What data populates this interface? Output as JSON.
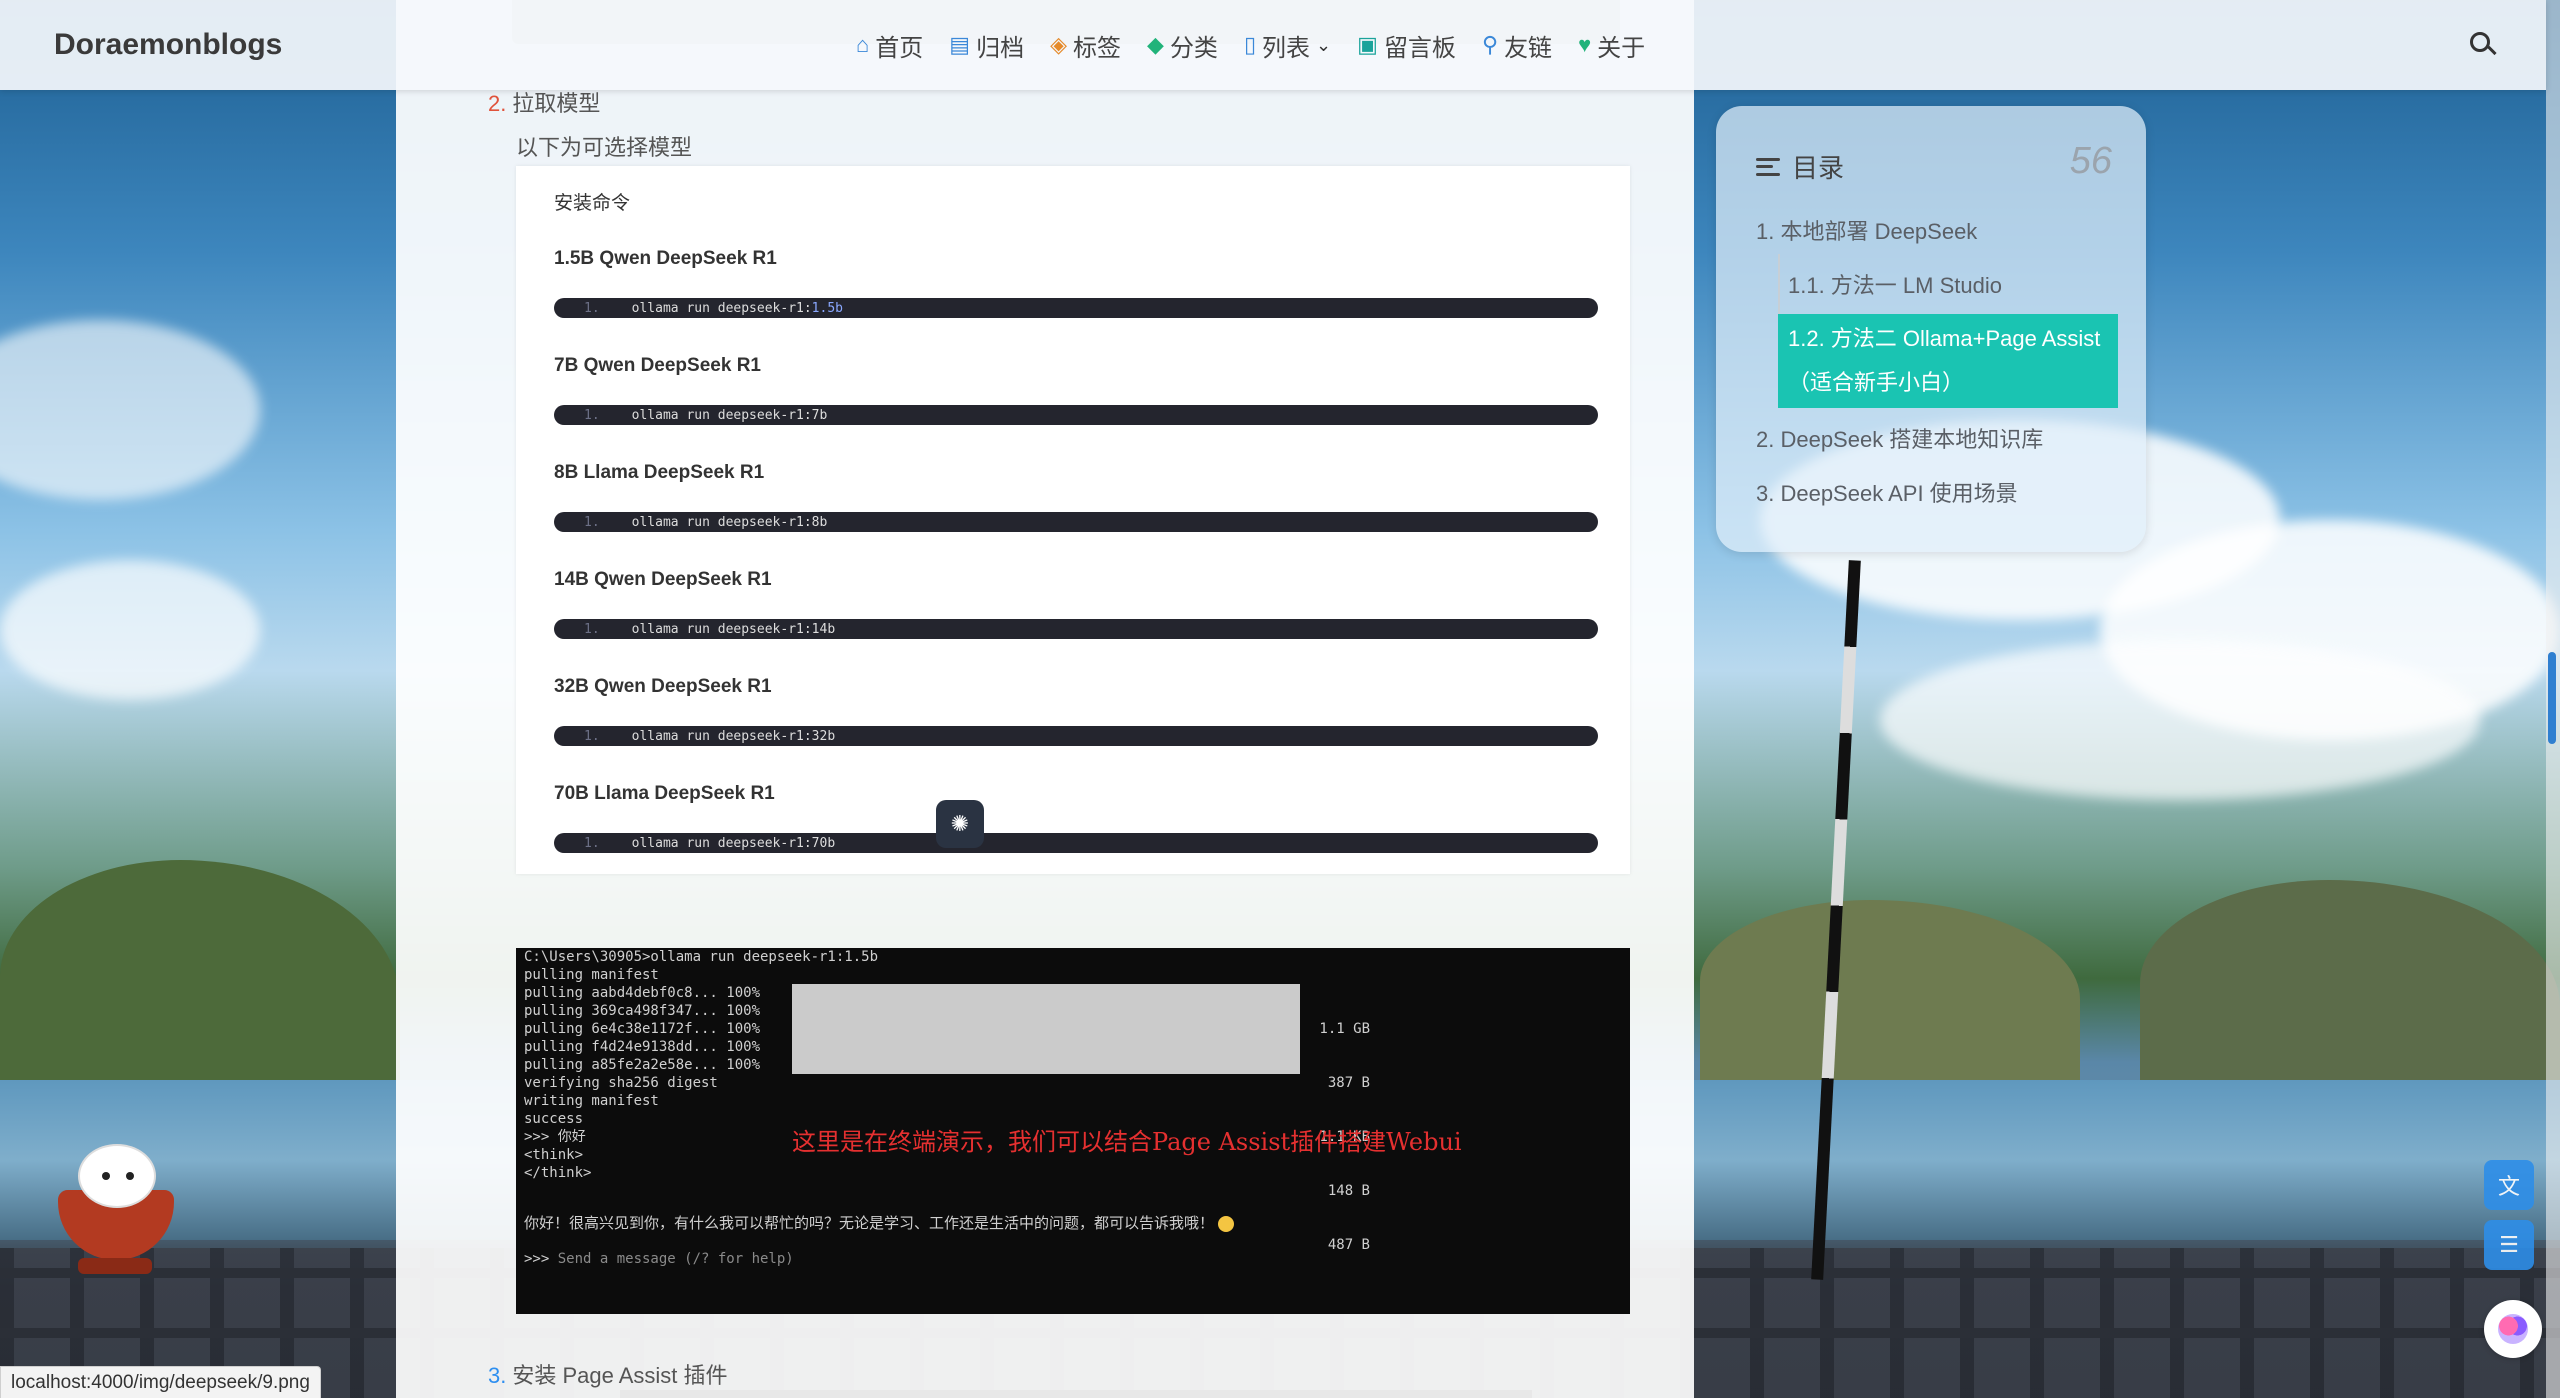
{
  "header": {
    "brand": "Doraemonblogs",
    "nav": [
      {
        "label": "首页",
        "icon": "home-icon"
      },
      {
        "label": "归档",
        "icon": "archive-icon"
      },
      {
        "label": "标签",
        "icon": "tag-icon"
      },
      {
        "label": "分类",
        "icon": "category-icon"
      },
      {
        "label": "列表",
        "icon": "list-icon"
      },
      {
        "label": "留言板",
        "icon": "message-board-icon"
      },
      {
        "label": "友链",
        "icon": "link-icon"
      },
      {
        "label": "关于",
        "icon": "heart-icon"
      }
    ],
    "search_icon": "search-icon"
  },
  "article": {
    "step2_num": "2.",
    "step2_label": "拉取模型",
    "step2_sub": "以下为可选择模型",
    "models_head": "安装命令",
    "models": [
      {
        "title": "1.5B Qwen DeepSeek R1",
        "line_no": "1.",
        "cmd_prefix": "ollama run deepseek-r1:",
        "cmd_tag": "1.5b"
      },
      {
        "title": "7B Qwen DeepSeek R1",
        "line_no": "1.",
        "cmd_prefix": "ollama run deepseek-r1:7b",
        "cmd_tag": ""
      },
      {
        "title": "8B Llama DeepSeek R1",
        "line_no": "1.",
        "cmd_prefix": "ollama run deepseek-r1:8b",
        "cmd_tag": ""
      },
      {
        "title": "14B Qwen DeepSeek R1",
        "line_no": "1.",
        "cmd_prefix": "ollama run deepseek-r1:14b",
        "cmd_tag": ""
      },
      {
        "title": "32B Qwen DeepSeek R1",
        "line_no": "1.",
        "cmd_prefix": "ollama run deepseek-r1:32b",
        "cmd_tag": ""
      },
      {
        "title": "70B Llama DeepSeek R1",
        "line_no": "1.",
        "cmd_prefix": "ollama run deepseek-r1:70b",
        "cmd_tag": ""
      }
    ],
    "terminal": {
      "lines": [
        "C:\\Users\\30905>ollama run deepseek-r1:1.5b",
        "pulling manifest",
        "pulling aabd4debf0c8... 100%",
        "pulling 369ca498f347... 100%",
        "pulling 6e4c38e1172f... 100%",
        "pulling f4d24e9138dd... 100%",
        "pulling a85fe2a2e58e... 100%",
        "verifying sha256 digest",
        "writing manifest",
        "success",
        ">>> 你好",
        "<think>",
        "",
        "</think>"
      ],
      "sizes": [
        "1.1 GB",
        "387 B",
        "1.1 KB",
        "148 B",
        "487 B"
      ],
      "note": "这里是在终端演示，我们可以结合Page Assist插件搭建Webui",
      "reply": "你好！很高兴见到你，有什么我可以帮忙的吗？无论是学习、工作还是生活中的问题，都可以告诉我哦！",
      "prompt": ">>> ",
      "prompt_placeholder": "Send a message (/? for help)"
    },
    "step3_num": "3.",
    "step3_label": "安装 Page Assist 插件"
  },
  "toc": {
    "title": "目录",
    "count": "56",
    "items": [
      "1. 本地部署 DeepSeek",
      "1.1. 方法一 LM Studio",
      "1.2. 方法二 Ollama+Page Assist（适合新手小白）",
      "2. DeepSeek 搭建本地知识库",
      "3. DeepSeek API 使用场景"
    ]
  },
  "status_url": "localhost:4000/img/deepseek/9.png",
  "colors": {
    "accent": "#1ac4b2",
    "step_red": "#e0523b",
    "step_blue": "#2d8ef0",
    "note_red": "#e53030"
  }
}
